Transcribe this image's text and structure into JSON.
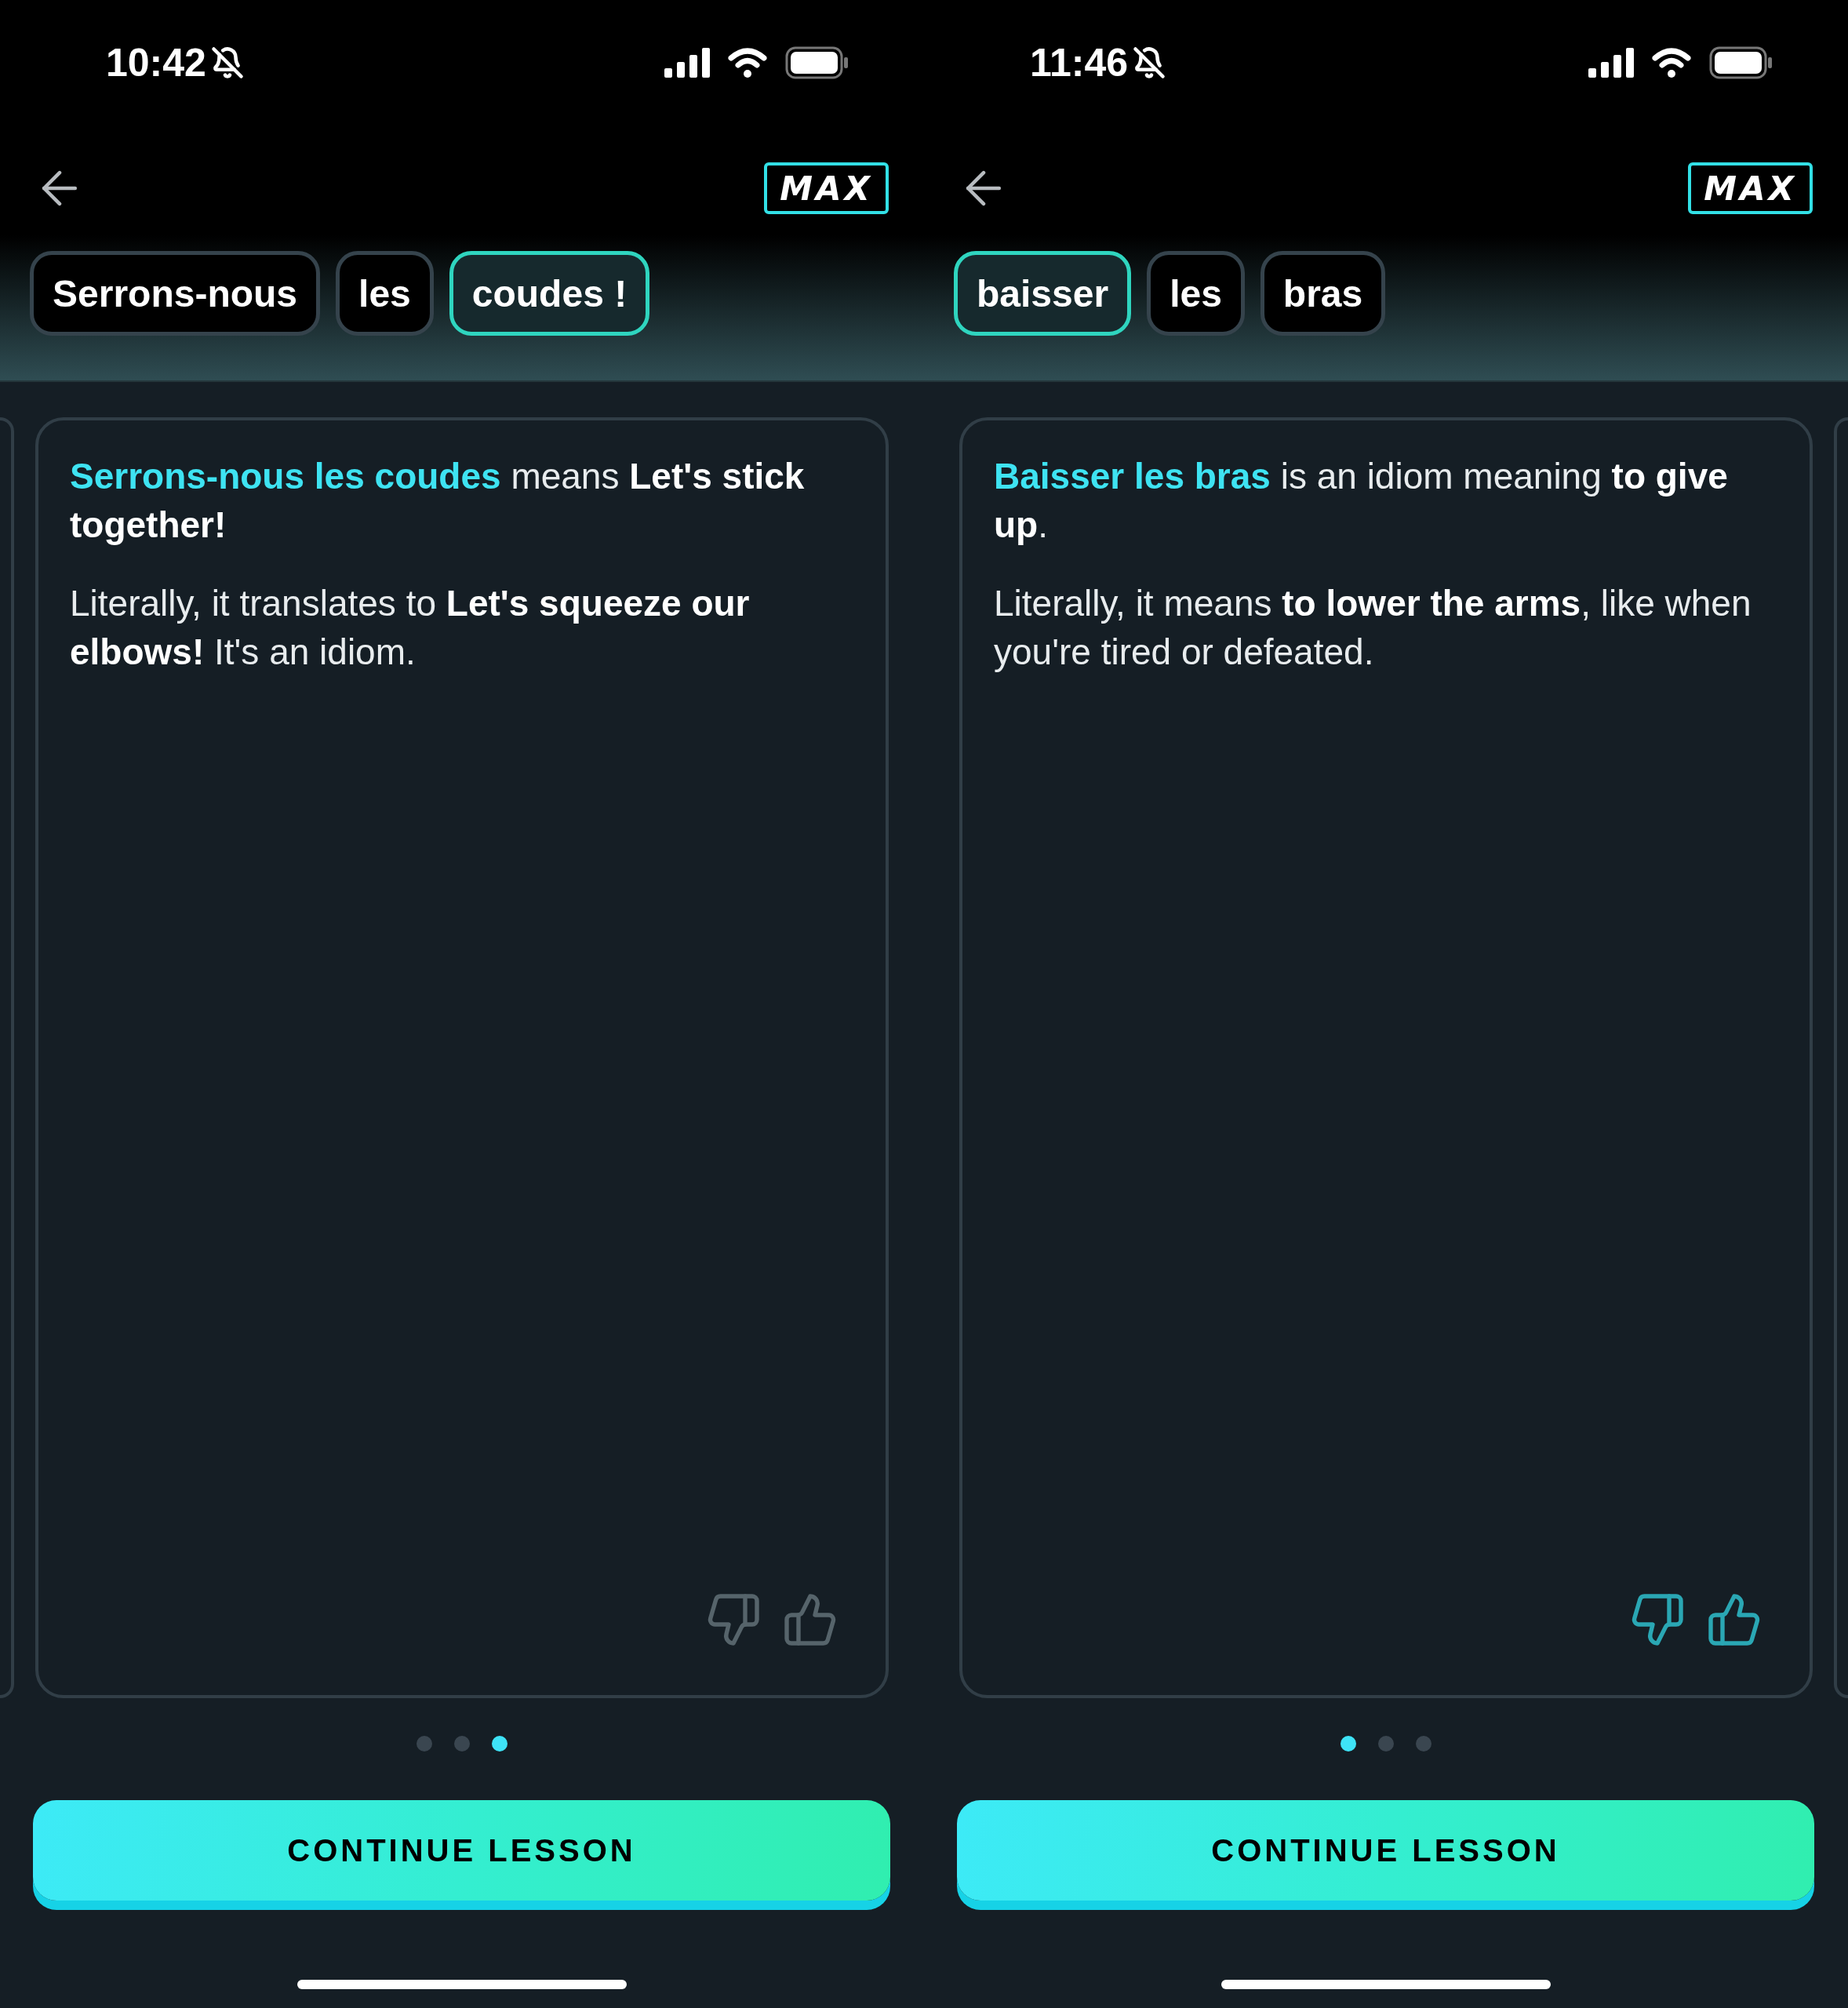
{
  "screens": [
    {
      "status_bar": {
        "time": "10:42"
      },
      "logo": "MAX",
      "chips": [
        {
          "label": "Serrons-nous",
          "selected": false
        },
        {
          "label": "les",
          "selected": false
        },
        {
          "label": "coudes !",
          "selected": true
        }
      ],
      "adjacent_card": {
        "kind": "left"
      },
      "card": {
        "paragraphs": [
          [
            {
              "text": "Serrons-nous les coudes",
              "kind": "accent"
            },
            {
              "text": " means ",
              "kind": "plain"
            },
            {
              "text": "Let's stick together!",
              "kind": "bold"
            }
          ],
          [
            {
              "text": "Literally, it translates to ",
              "kind": "plain"
            },
            {
              "text": "Let's squeeze our elbows!",
              "kind": "bold"
            },
            {
              "text": " It's an idiom.",
              "kind": "plain"
            }
          ]
        ],
        "feedback_highlighted": false
      },
      "pager": [
        {
          "selected": false
        },
        {
          "selected": false
        },
        {
          "selected": true
        }
      ],
      "button": "CONTINUE LESSON"
    },
    {
      "status_bar": {
        "time": "11:46"
      },
      "logo": "MAX",
      "chips": [
        {
          "label": "baisser",
          "selected": true
        },
        {
          "label": "les",
          "selected": false
        },
        {
          "label": "bras",
          "selected": false
        }
      ],
      "adjacent_card": {
        "kind": "right"
      },
      "card": {
        "paragraphs": [
          [
            {
              "text": "Baisser les bras",
              "kind": "accent"
            },
            {
              "text": " is an idiom meaning ",
              "kind": "plain"
            },
            {
              "text": "to give up",
              "kind": "bold"
            },
            {
              "text": ".",
              "kind": "plain"
            }
          ],
          [
            {
              "text": "Literally, it means ",
              "kind": "plain"
            },
            {
              "text": "to lower the arms",
              "kind": "bold"
            },
            {
              "text": ", like when you're tired or defeated.",
              "kind": "plain"
            }
          ]
        ],
        "feedback_highlighted": true
      },
      "pager": [
        {
          "selected": true
        },
        {
          "selected": false
        },
        {
          "selected": false
        }
      ],
      "button": "CONTINUE LESSON"
    }
  ]
}
